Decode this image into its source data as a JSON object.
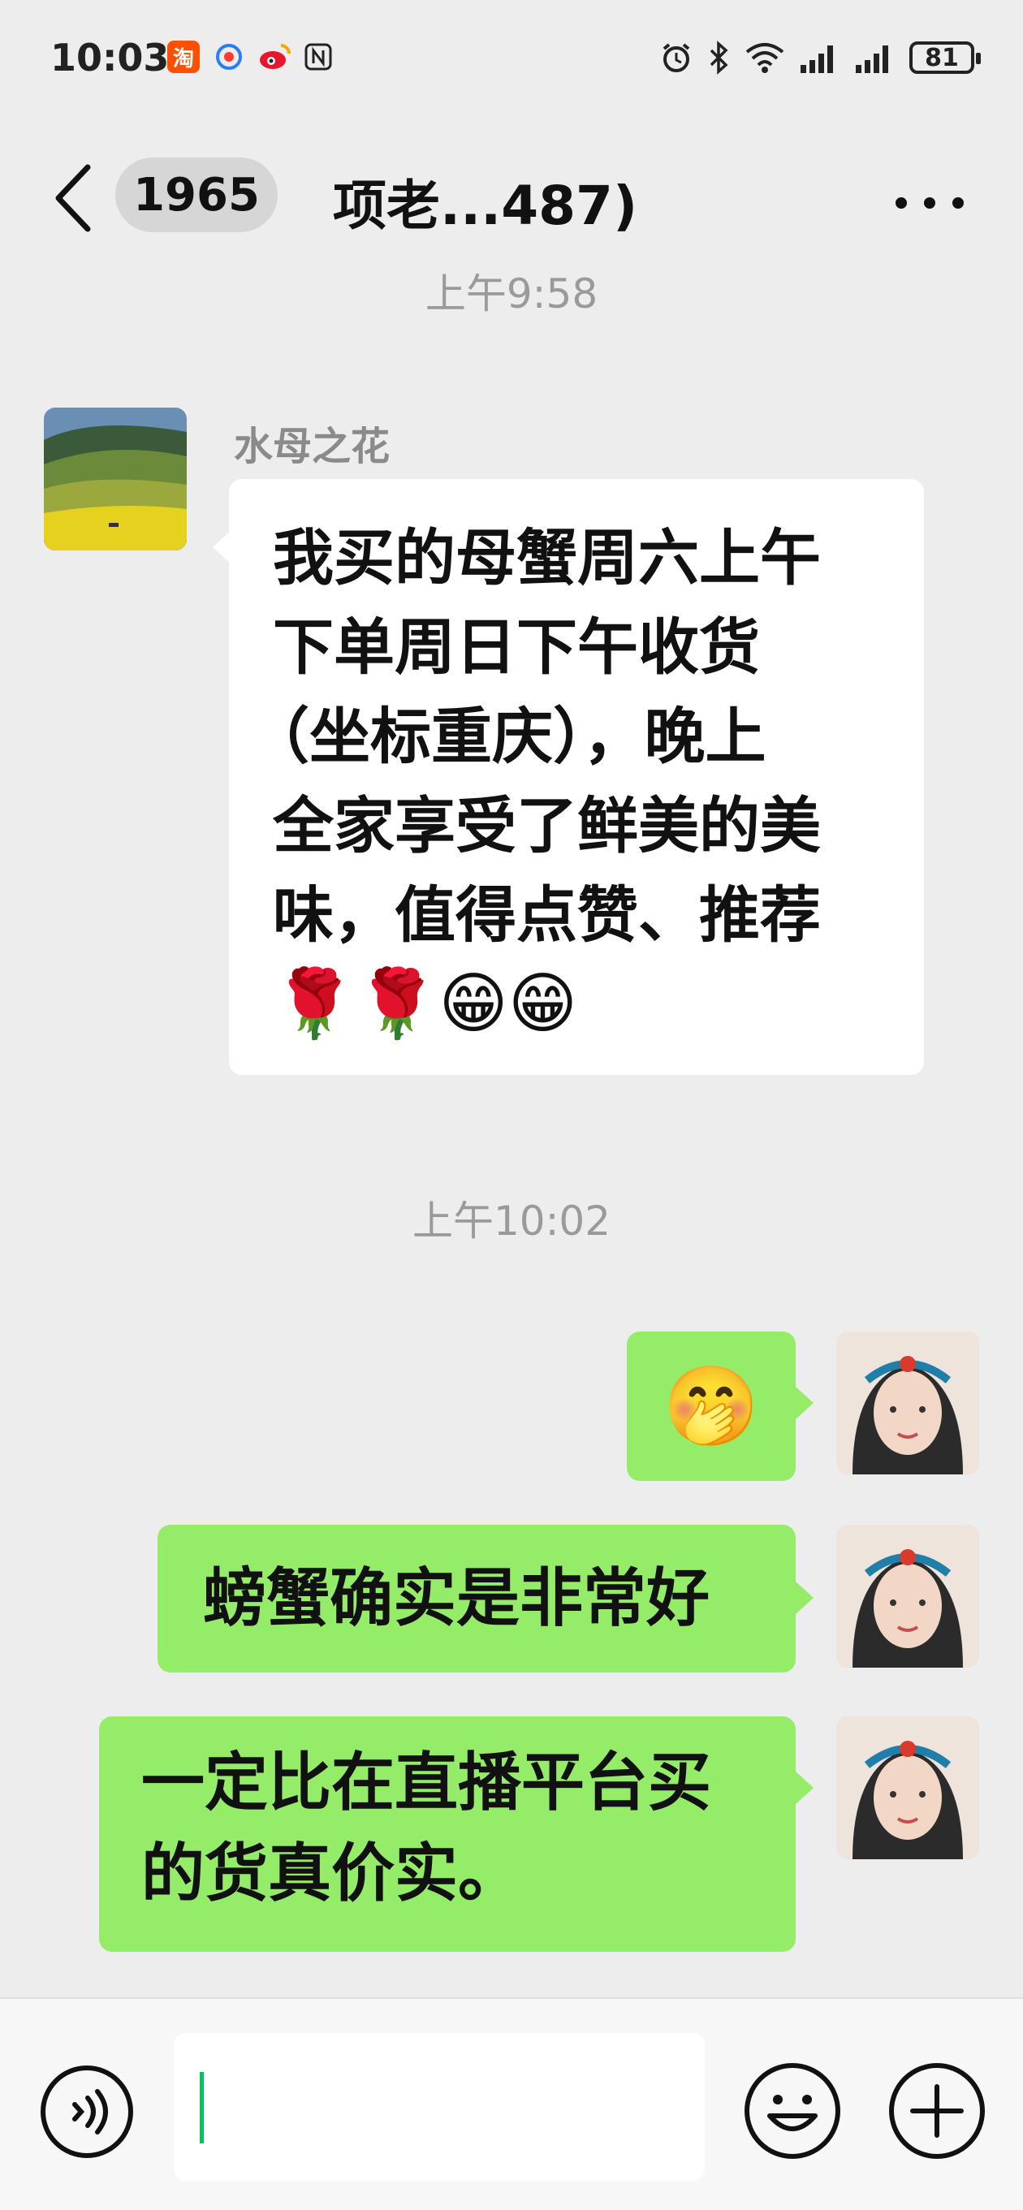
{
  "status_bar": {
    "time": "10:03",
    "battery": "81"
  },
  "header": {
    "unread_count": "1965",
    "title": "项老...487)"
  },
  "messages": {
    "time_1": "上午9:58",
    "incoming": {
      "sender": "水母之花",
      "lines": [
        "我买的母蟹周六上午",
        "下单周日下午收货",
        "（坐标重庆），晚上",
        "全家享受了鲜美的美",
        "味，值得点赞、推荐"
      ],
      "emojis": "🌹🌹😁😁"
    },
    "time_2": "上午10:02",
    "outgoing": [
      {
        "text": "🤭"
      },
      {
        "text": "螃蟹确实是非常好"
      },
      {
        "lines": [
          "一定比在直播平台买",
          "的货真价实。"
        ]
      }
    ]
  },
  "colors": {
    "background": "#ededed",
    "outgoing_bubble": "#95ec69",
    "incoming_bubble": "#ffffff",
    "caret": "#07c160"
  }
}
